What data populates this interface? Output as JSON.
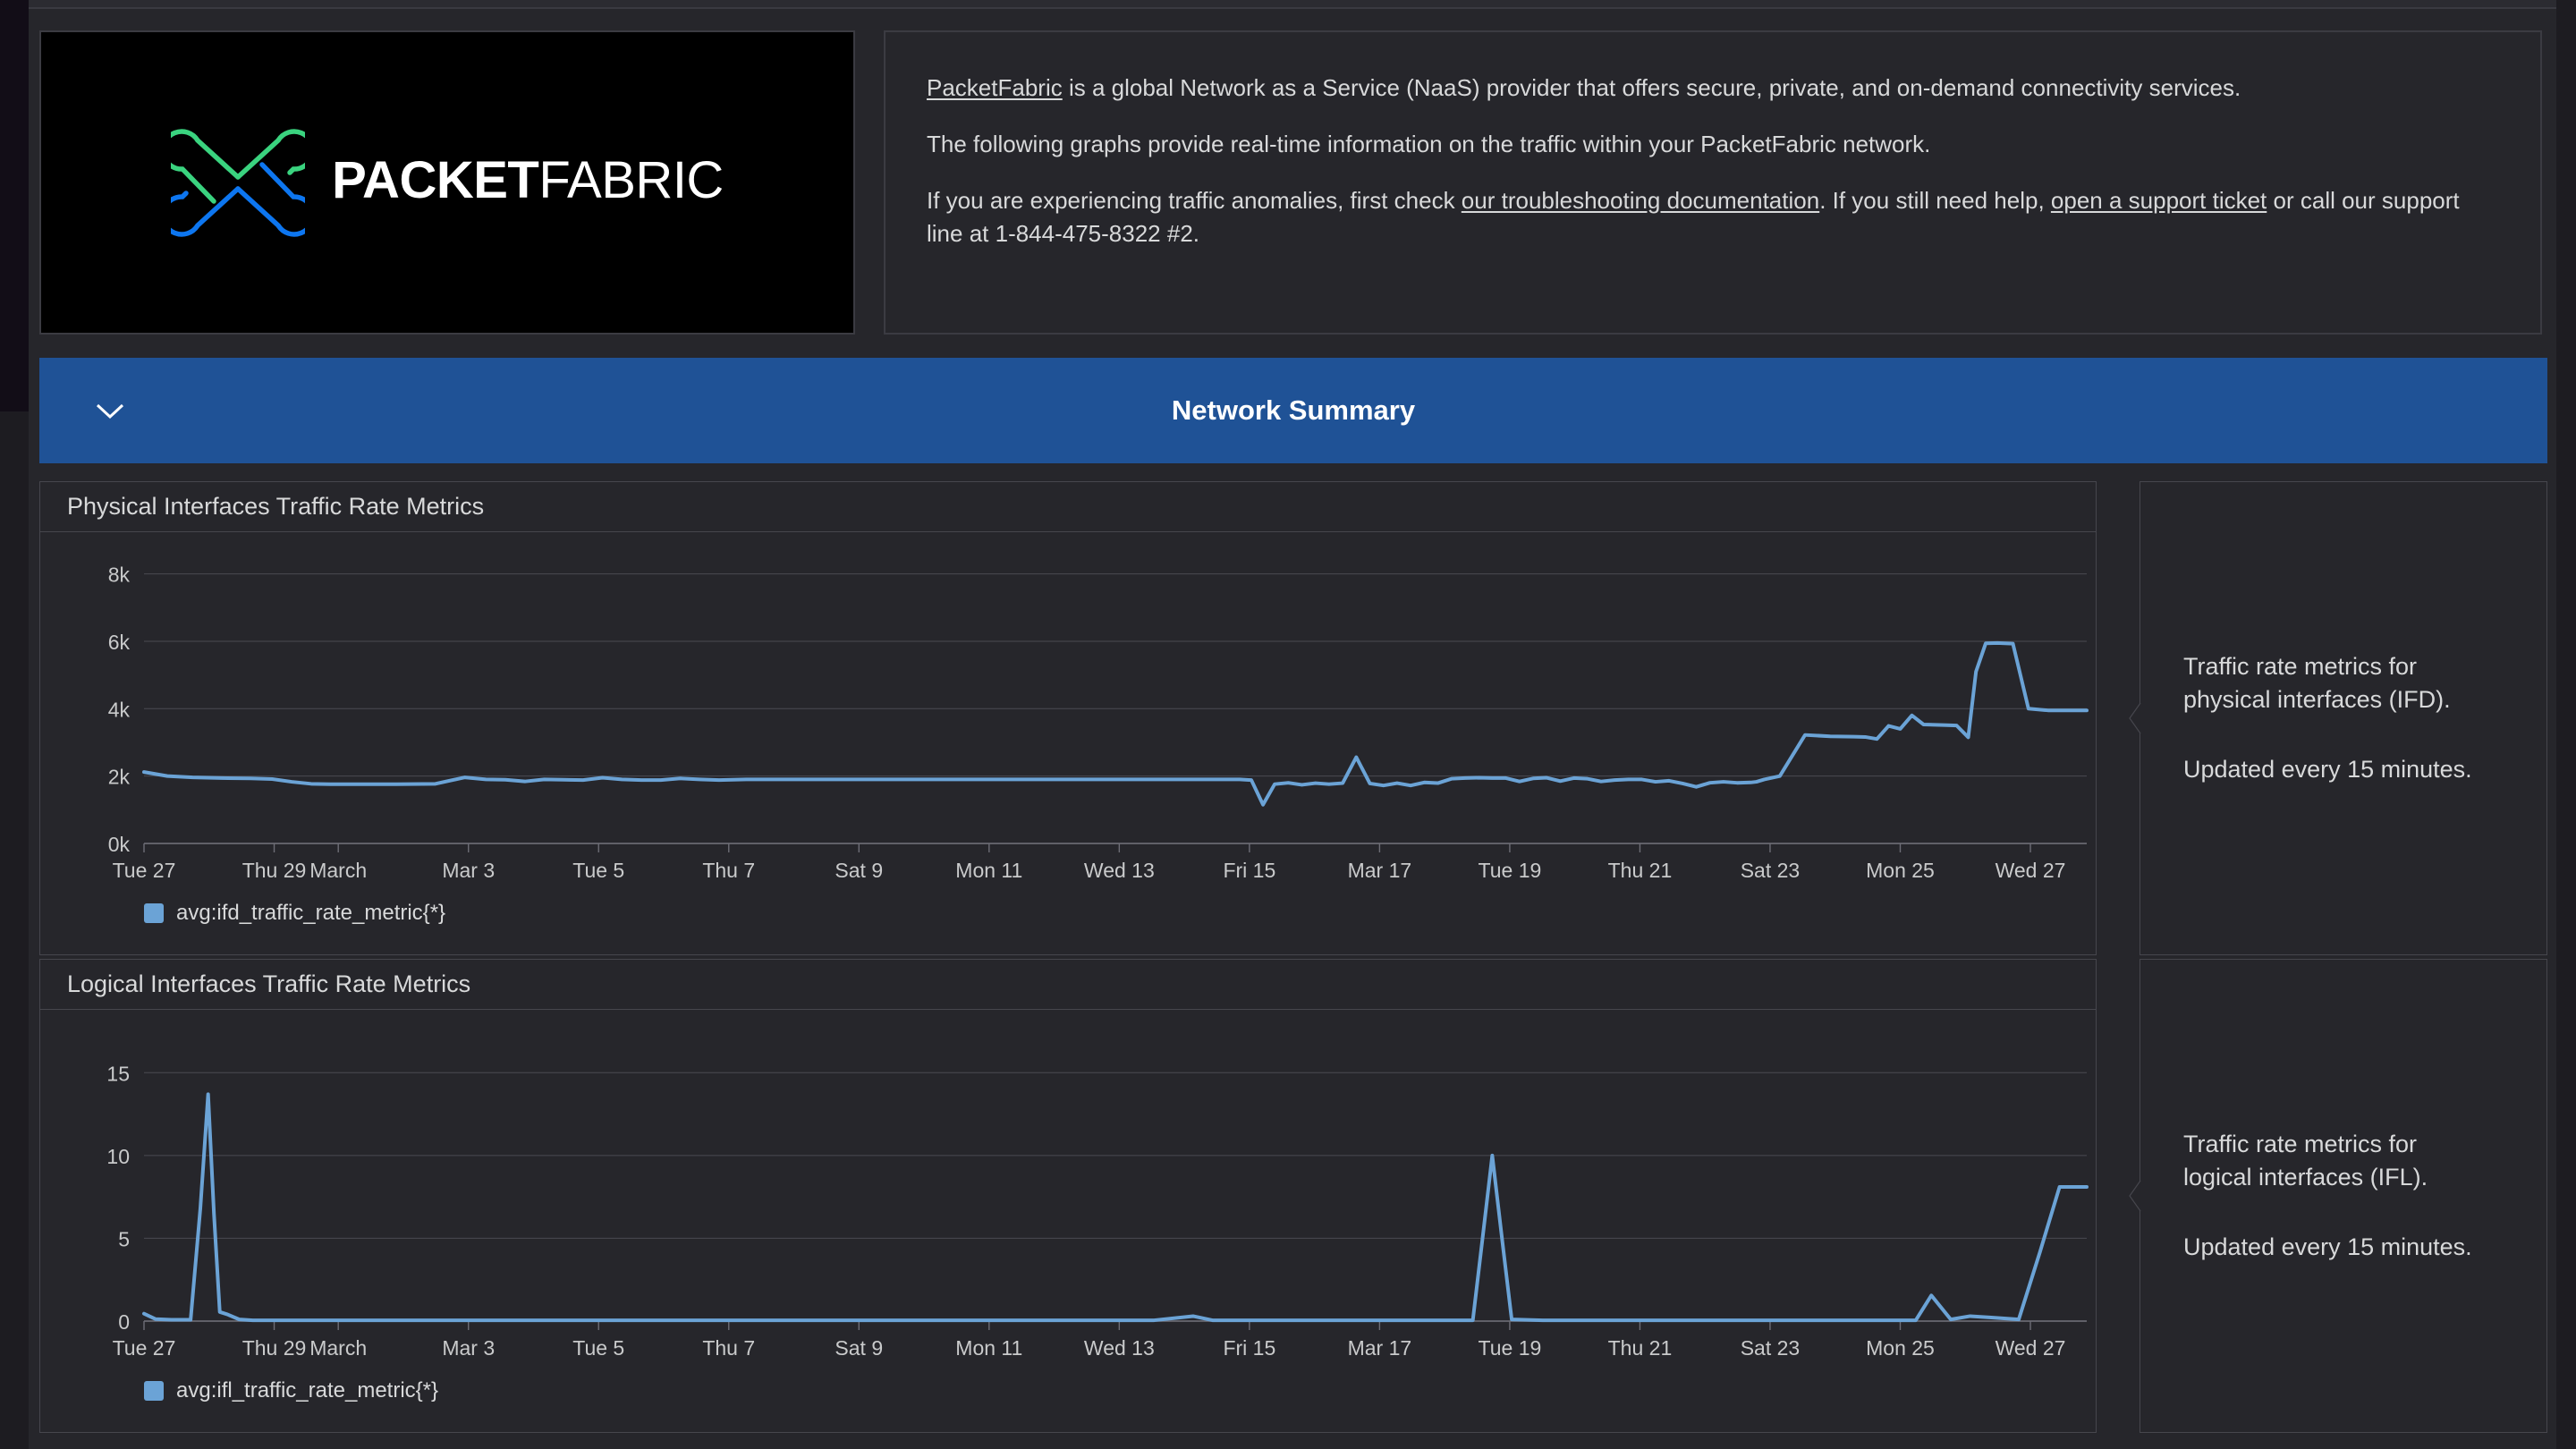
{
  "brand": {
    "logo_name_bold": "PACKET",
    "logo_name_light": "FABRIC",
    "logo_green": "#3ad37f",
    "logo_blue": "#0d76f0"
  },
  "intro": {
    "line1_link": "PacketFabric",
    "line1_rest": " is a global Network as a Service (NaaS) provider that offers secure, private, and on-demand connectivity services.",
    "line2": "The following graphs provide real-time information on the traffic within your PacketFabric network.",
    "line3_a": "If you are experiencing traffic anomalies, first check ",
    "line3_link1": "our troubleshooting documentation",
    "line3_b": ". If you still need help, ",
    "line3_link2": "open a support ticket",
    "line3_c": " or call our support line at 1-844-475-8322 #2."
  },
  "section": {
    "title": "Network Summary",
    "collapse_icon": "chevron-down-icon",
    "accent": "#1f5296"
  },
  "charts": [
    {
      "title": "Physical Interfaces Traffic Rate Metrics",
      "legend_label": "avg:ifd_traffic_rate_metric{*}",
      "note_line1": "Traffic rate metrics for",
      "note_line2": "physical interfaces (IFD).",
      "note_line3": "Updated every 15 minutes."
    },
    {
      "title": "Logical Interfaces Traffic Rate Metrics",
      "legend_label": "avg:ifl_traffic_rate_metric{*}",
      "note_line1": "Traffic rate metrics for",
      "note_line2": "logical interfaces (IFL).",
      "note_line3": "Updated every 15 minutes."
    }
  ],
  "chart_data": [
    {
      "type": "line",
      "title": "Physical Interfaces Traffic Rate Metrics",
      "series_name": "avg:ifd_traffic_rate_metric{*}",
      "color": "#6ba3d6",
      "xlabel": "",
      "ylabel": "",
      "ylim": [
        0,
        8600
      ],
      "yticks": [
        0,
        2000,
        4000,
        6000,
        8000
      ],
      "ytick_labels": [
        "0k",
        "2k",
        "4k",
        "6k",
        "8k"
      ],
      "grid": true,
      "legend_position": "bottom-left",
      "xtick_labels": [
        "Tue 27",
        "Thu 29",
        "March",
        "Mar 3",
        "Tue 5",
        "Thu 7",
        "Sat 9",
        "Mon 11",
        "Wed 13",
        "Fri 15",
        "Mar 17",
        "Tue 19",
        "Thu 21",
        "Sat 23",
        "Mon 25",
        "Wed 27"
      ],
      "xtick_positions": [
        0,
        6.7,
        10.0,
        16.7,
        23.4,
        30.1,
        36.8,
        43.5,
        50.2,
        56.9,
        63.6,
        70.3,
        77.0,
        83.7,
        90.4,
        97.1
      ],
      "x": [
        0,
        1.2,
        2.5,
        4.0,
        5.5,
        6.6,
        7.6,
        8.6,
        9.6,
        11.0,
        13.0,
        15.0,
        16.5,
        17.6,
        18.6,
        19.6,
        20.6,
        21.6,
        22.6,
        23.6,
        24.6,
        25.6,
        26.6,
        27.6,
        28.6,
        29.6,
        31.0,
        34.0,
        38.0,
        42.0,
        46.0,
        50.0,
        53.0,
        55.6,
        56.4,
        57.0,
        57.6,
        58.2,
        58.9,
        59.6,
        60.3,
        61.0,
        61.7,
        62.4,
        63.1,
        63.8,
        64.5,
        65.2,
        65.9,
        66.6,
        67.3,
        68.0,
        68.7,
        69.4,
        70.1,
        70.8,
        71.5,
        72.2,
        72.9,
        73.6,
        74.3,
        75.0,
        75.7,
        76.4,
        77.1,
        77.8,
        78.5,
        79.2,
        79.9,
        80.6,
        81.3,
        82.0,
        82.7,
        83.0,
        83.4,
        84.2,
        85.5,
        86.8,
        88.0,
        88.6,
        89.2,
        89.8,
        90.4,
        91.0,
        91.6,
        92.2,
        92.8,
        93.3,
        93.9,
        94.3,
        94.8,
        95.4,
        96.2,
        97.0,
        98.0,
        99.0,
        100.0
      ],
      "y": [
        2120,
        2000,
        1960,
        1940,
        1930,
        1910,
        1830,
        1770,
        1760,
        1760,
        1760,
        1770,
        1960,
        1900,
        1890,
        1840,
        1900,
        1890,
        1880,
        1950,
        1900,
        1880,
        1880,
        1930,
        1900,
        1880,
        1900,
        1900,
        1900,
        1900,
        1900,
        1900,
        1900,
        1900,
        1900,
        1880,
        1150,
        1760,
        1800,
        1740,
        1790,
        1760,
        1790,
        2560,
        1780,
        1720,
        1790,
        1720,
        1810,
        1790,
        1920,
        1940,
        1950,
        1940,
        1940,
        1840,
        1930,
        1950,
        1850,
        1940,
        1920,
        1840,
        1880,
        1900,
        1900,
        1830,
        1860,
        1780,
        1680,
        1800,
        1830,
        1800,
        1810,
        1830,
        1900,
        2000,
        3220,
        3180,
        3170,
        3160,
        3100,
        3490,
        3400,
        3800,
        3530,
        3520,
        3510,
        3500,
        3150,
        5100,
        5940,
        5950,
        5930,
        4000,
        3950,
        3950,
        3950
      ]
    },
    {
      "type": "line",
      "title": "Logical Interfaces Traffic Rate Metrics",
      "series_name": "avg:ifl_traffic_rate_metric{*}",
      "color": "#6ba3d6",
      "xlabel": "",
      "ylabel": "",
      "ylim": [
        0,
        17.5
      ],
      "yticks": [
        0,
        5,
        10,
        15
      ],
      "ytick_labels": [
        "0",
        "5",
        "10",
        "15"
      ],
      "grid": true,
      "legend_position": "bottom-left",
      "xtick_labels": [
        "Tue 27",
        "Thu 29",
        "March",
        "Mar 3",
        "Tue 5",
        "Thu 7",
        "Sat 9",
        "Mon 11",
        "Wed 13",
        "Fri 15",
        "Mar 17",
        "Tue 19",
        "Thu 21",
        "Sat 23",
        "Mon 25",
        "Wed 27"
      ],
      "xtick_positions": [
        0,
        6.7,
        10.0,
        16.7,
        23.4,
        30.1,
        36.8,
        43.5,
        50.2,
        56.9,
        63.6,
        70.3,
        77.0,
        83.7,
        90.4,
        97.1
      ],
      "x": [
        0,
        0.6,
        1.4,
        2.4,
        2.9,
        3.3,
        3.6,
        3.9,
        4.3,
        4.9,
        5.6,
        8.0,
        15.0,
        25.0,
        35.0,
        45.0,
        52.0,
        54.0,
        55.0,
        56.0,
        57.0,
        60.0,
        65.0,
        68.4,
        68.9,
        69.4,
        69.9,
        70.4,
        72.0,
        78.0,
        85.0,
        88.0,
        89.5,
        90.4,
        91.2,
        92.0,
        93.0,
        94.0,
        95.0,
        96.5,
        97.6,
        98.6,
        99.3,
        100.0
      ],
      "y": [
        0.45,
        0.12,
        0.08,
        0.08,
        6.8,
        13.7,
        6.5,
        0.55,
        0.4,
        0.1,
        0.05,
        0.05,
        0.05,
        0.05,
        0.05,
        0.05,
        0.05,
        0.3,
        0.05,
        0.05,
        0.05,
        0.05,
        0.05,
        0.05,
        5.0,
        10.0,
        5.0,
        0.1,
        0.05,
        0.05,
        0.05,
        0.05,
        0.05,
        0.05,
        0.05,
        1.55,
        0.1,
        0.3,
        0.22,
        0.1,
        4.2,
        8.1,
        8.1,
        8.1
      ]
    }
  ]
}
